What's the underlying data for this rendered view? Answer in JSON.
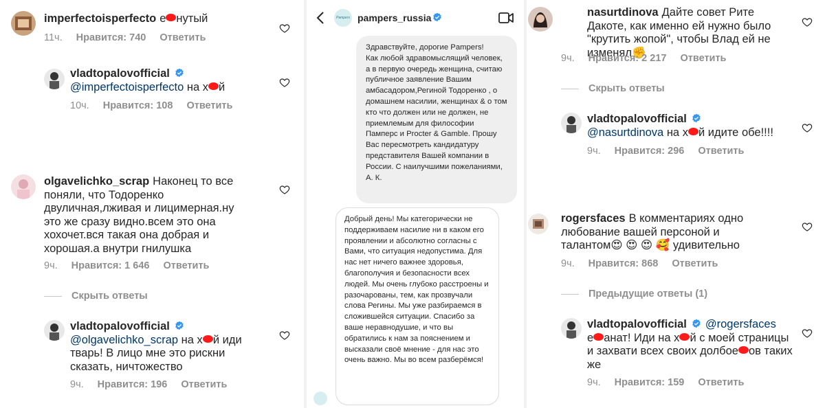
{
  "left": {
    "c1": {
      "username": "imperfectoisperfecto",
      "text_before": "е",
      "text_after": "нутый",
      "time": "11ч.",
      "likes": "Нравится: 740",
      "reply": "Ответить"
    },
    "c1r": {
      "username": "vladtopalovofficial",
      "mention": "@imperfectoisperfecto",
      "text_before": " на х",
      "text_after": "й",
      "time": "10ч.",
      "likes": "Нравится: 108",
      "reply": "Ответить"
    },
    "c2": {
      "username": "olgavelichko_scrap",
      "text": "Наконец то все поняли, что  Тодоренко двуличная,лживая и лицимерная.ну это же сразу видно.всем это она хохочет.вся такая она добрая и хорошая.а внутри гнилушка",
      "time": "9ч.",
      "likes": "Нравится: 1 646",
      "reply": "Ответить"
    },
    "hide": "Скрыть ответы",
    "c2r": {
      "username": "vladtopalovofficial",
      "mention": "@olgavelichko_scrap",
      "text_before": " на х",
      "text_after": "й иди тварь! В лицо мне это рискни сказать, ничтожество",
      "time": "9ч.",
      "likes": "Нравится: 196",
      "reply": "Ответить"
    }
  },
  "middle": {
    "header": {
      "account": "pampers_russia",
      "back_icon": "chevron-left-icon",
      "video_icon": "video-call-icon",
      "brand_color": "#2b7b8f"
    },
    "logo_text": "Pampers",
    "out_message": "Здравствуйте, дорогие Pampers!\nКак любой здравомыслящий человек, а в первую очередь женщина, считаю публичное заявление Вашим амбасадором,Регинoй Тодоренко , о домашнем насилии, женщинах & о том кто что должен или не должен, не приемлемым для философии Памперс и Procter & Gamble. Прошу Вас пересмотреть кандидатуру представителя Вашей компании в России. С наилучшими пожеланиями, А. К.",
    "in_message": "Добрый день! Мы категорически не поддерживаем насилие ни в каком его проявлении и абсолютно согласны с Вами, что ситуация недопустима. Для нас нет ничего важнее здоровья, благополучия и безопасности всех людей. Мы очень глубоко расстроены и разочарованы, тем, как прозвучали слова Регины. Мы уже разбираемся в сложившейся ситуации. Спасибо за ваше неравнодушие, и что вы обратились к нам за пояснением и высказали своё мнение - для нас это очень важно. Мы во всем разберёмся!"
  },
  "right": {
    "c3": {
      "username": "nasurtdinova",
      "text": "Дайте совет Рите Дакоте, как именно ей нужно было \"крутить жопой\", чтобы Влад ей не изменял",
      "emoji": "✊",
      "time": "9ч.",
      "likes": "Нравится: 2 217",
      "reply": "Ответить"
    },
    "hide": "Скрыть ответы",
    "c3r": {
      "username": "vladtopalovofficial",
      "mention": "@nasurtdinova",
      "text_before": " на х",
      "text_after": "й идите обе!!!!",
      "time": "9ч.",
      "likes": "Нравится: 296",
      "reply": "Ответить"
    },
    "c4": {
      "username": "rogersfaces",
      "text": "В комментариях одно любование вашей персоной и талантом",
      "emojis": "😍 😍 😍 🥰",
      "text_after": " удивительно",
      "time": "9ч.",
      "likes": "Нравится: 868",
      "reply": "Ответить"
    },
    "prev": "Предыдущие ответы (1)",
    "c4r": {
      "username": "vladtopalovofficial",
      "mention": "@rogersfaces",
      "text_1": "е",
      "text_2": "анат! Иди на х",
      "text_3": "й с моей страницы и захвати всех своих долбое",
      "text_4": "ов таких же",
      "time": "9ч.",
      "likes": "Нравится: 159",
      "reply": "Ответить"
    }
  },
  "colors": {
    "mention": "#00376b",
    "verified": "#3897f0",
    "censor": "#ff1a1a",
    "meta": "#8e8e8e"
  }
}
